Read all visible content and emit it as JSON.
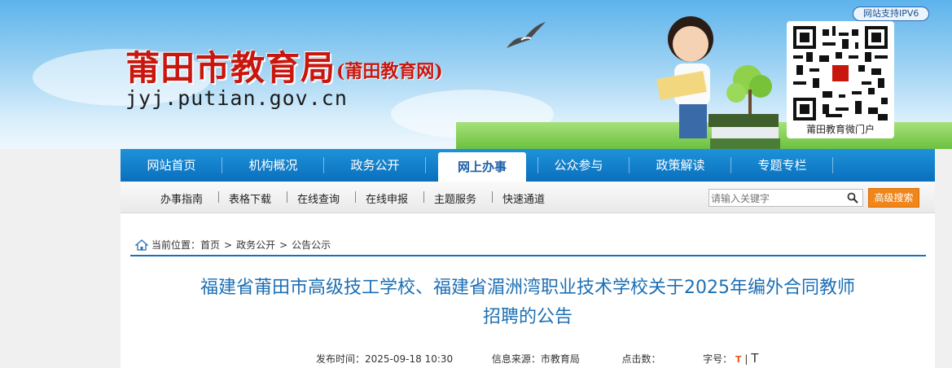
{
  "header": {
    "site_title": "莆田市教育局",
    "site_subtitle": "(莆田教育网)",
    "site_url": "jyj.putian.gov.cn",
    "ipv6_badge": "网站支持IPV6",
    "qr_label": "莆田教育微门户"
  },
  "nav": {
    "items": [
      "网站首页",
      "机构概况",
      "政务公开",
      "网上办事",
      "公众参与",
      "政策解读",
      "专题专栏"
    ],
    "active": "网上办事"
  },
  "subnav": {
    "items": [
      "办事指南",
      "表格下载",
      "在线查询",
      "在线申报",
      "主题服务",
      "快速通道"
    ],
    "search_placeholder": "请输入关键字",
    "advanced_search": "高级搜索"
  },
  "breadcrumb": {
    "prefix": "当前位置：",
    "items": [
      "首页",
      "政务公开",
      "公告公示"
    ],
    "separator": ">"
  },
  "article": {
    "title_line1": "福建省莆田市高级技工学校、福建省湄洲湾职业技术学校关于2025年编外合同教师",
    "title_line2": "招聘的公告",
    "publish_label": "发布时间：",
    "publish_time": "2025-09-18 10:30",
    "source_label": "信息来源：",
    "source": "市教育局",
    "clicks_label": "点击数：",
    "font_label": "字号：",
    "font_small": "T",
    "font_divider": "|",
    "font_big": "T"
  },
  "colors": {
    "nav_blue": "#0a6fbd",
    "title_red": "#c8170f",
    "article_title": "#1d6fb4",
    "search_orange": "#f08519"
  }
}
